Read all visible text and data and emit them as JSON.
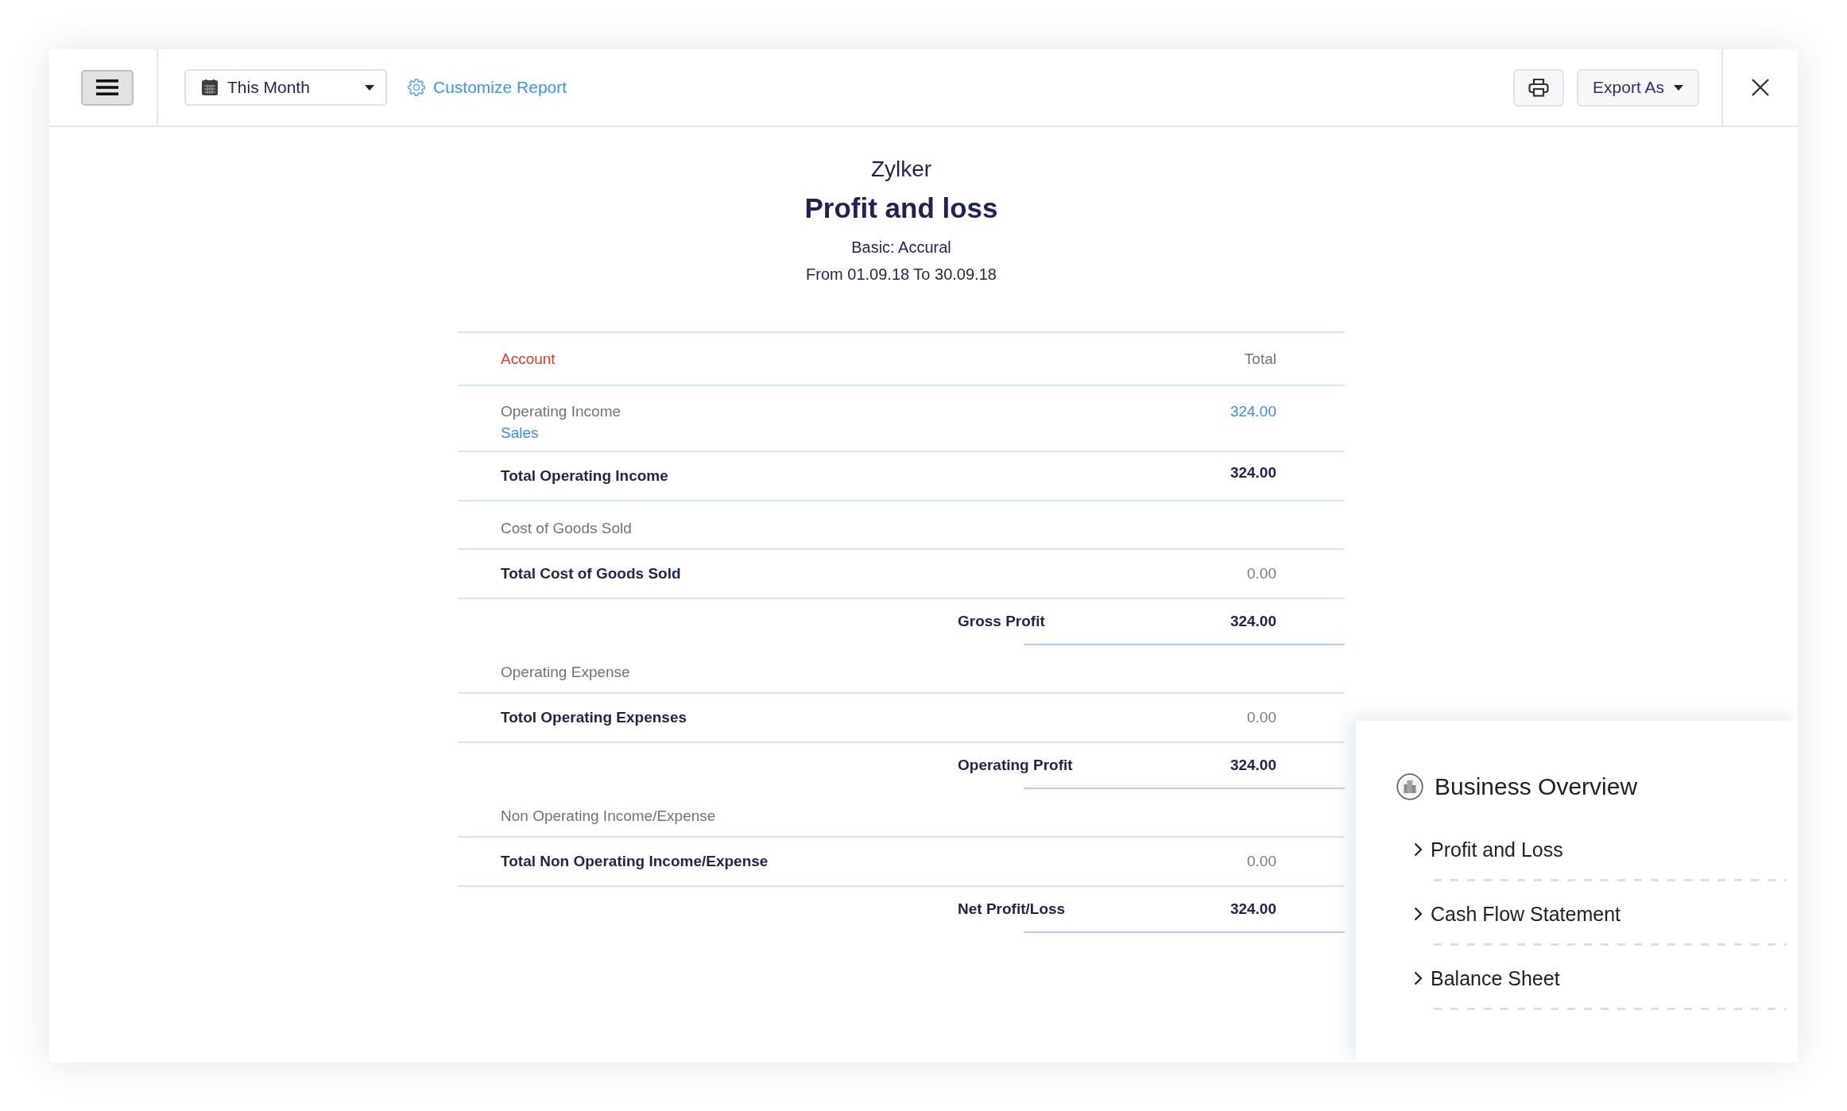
{
  "toolbar": {
    "period_dropdown": {
      "value": "This Month"
    },
    "customize_link": "Customize Report",
    "export_button": "Export As"
  },
  "report": {
    "company": "Zylker",
    "title": "Profit and loss",
    "basis": "Basic: Accural",
    "period": "From 01.09.18 To 30.09.18"
  },
  "table": {
    "columns": [
      {
        "label": "Account",
        "color": "#e2372b"
      },
      {
        "label": "Total",
        "color": "#6f7284"
      }
    ],
    "rows": [
      {
        "kind": "group",
        "label": "Operating Income",
        "link": "Sales",
        "amount": "324.00"
      },
      {
        "kind": "total",
        "label": "Total Operating Income",
        "amount": "324.00",
        "highlighted": true
      },
      {
        "kind": "group",
        "label": "Cost of Goods Sold"
      },
      {
        "kind": "total",
        "label": "Total Cost of Goods Sold",
        "amount": "0.00",
        "highlighted": false
      },
      {
        "kind": "summary",
        "label": "Gross Profit",
        "amount": "324.00"
      },
      {
        "kind": "group",
        "label": "Operating Expense"
      },
      {
        "kind": "total",
        "label": "Totol Operating Expenses",
        "amount": "0.00",
        "highlighted": false
      },
      {
        "kind": "summary",
        "label": "Operating Profit",
        "amount": "324.00"
      },
      {
        "kind": "group",
        "label": "Non Operating Income/Expense"
      },
      {
        "kind": "total",
        "label": "Total Non Operating Income/Expense",
        "amount": "0.00",
        "highlighted": false
      },
      {
        "kind": "summary",
        "label": "Net Profit/Loss",
        "amount": "324.00"
      }
    ]
  },
  "business_overview": {
    "title": "Business Overview",
    "items": [
      {
        "label": "Profit and Loss"
      },
      {
        "label": "Cash Flow Statement"
      },
      {
        "label": "Balance Sheet"
      }
    ]
  }
}
